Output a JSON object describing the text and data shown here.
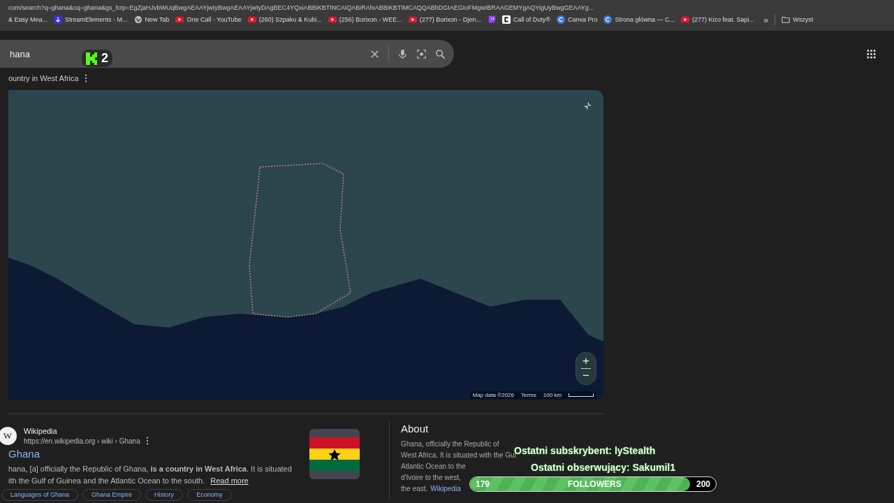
{
  "address_bar": {
    "url": "com/search?q=ghana&oq=ghana&gs_lcrp=EgZjaHJvbWUqBwgAEAAYjwIyBwgAEAAYjwIyDAgBEC4YQxiABBiKBTINCAIQABiRAhiABBiKBTIMCAQQABhDGIAEGIoFMgwIBRAAGEMYgAQYigUyBwgGEAAYg..."
  },
  "bookmarks": [
    {
      "kind": "none",
      "label": "& Easy Mea..."
    },
    {
      "kind": "streamelements",
      "label": "StreamElements - M..."
    },
    {
      "kind": "globe",
      "label": "New Tab"
    },
    {
      "kind": "youtube",
      "label": "One Call - YouTube"
    },
    {
      "kind": "youtube",
      "label": "(260) Szpaku & Kubi..."
    },
    {
      "kind": "youtube",
      "label": "(256) Borixon - WEE..."
    },
    {
      "kind": "youtube",
      "label": "(277) Borixon - Djen..."
    },
    {
      "kind": "twitch"
    },
    {
      "kind": "cod",
      "label": "Call of Duty®"
    },
    {
      "kind": "canva",
      "label": "Canva Pro"
    },
    {
      "kind": "canva",
      "label": "Strona główna — C..."
    },
    {
      "kind": "youtube",
      "label": "(277) Kizo feat. Sapi..."
    }
  ],
  "bookmarks_more": "»",
  "bookmarks_folder": "Wszyst",
  "search": {
    "value": "hana"
  },
  "stream_badge": {
    "count": "2"
  },
  "subtitle": "ountry in West Africa",
  "map": {
    "attribution": "Map data ©2026",
    "terms": "Terms",
    "scale": "100 km",
    "zoom_in": "+",
    "zoom_out": "−"
  },
  "result": {
    "logo_letter": "W",
    "site": "Wikipedia",
    "breadcrumb": "https://en.wikipedia.org › wiki › Ghana",
    "title": "Ghana",
    "snippet": [
      "hana, [a] officially the Republic of Ghana, **is a country in West Africa**. It is situated",
      "ith the Gulf of Guinea and the Atlantic Ocean to the south."
    ],
    "read_more": "Read more",
    "chips": [
      "Languages of Ghana",
      "Ghana Empire",
      "History",
      "Economy"
    ]
  },
  "about": {
    "heading": "About",
    "lines": [
      "Ghana, officially the Republic of",
      "West Africa. It is situated with the Gul",
      "Atlantic Ocean to the",
      "d'Ivoire to the west,",
      "the east."
    ],
    "link": "Wikipedia"
  },
  "overlay": {
    "subscriber": "Ostatni subskrybent: lyStealth",
    "follower": "Ostatni obserwujący: Sakumil1",
    "goal": {
      "current": "179",
      "label": "FOLLOWERS",
      "target": "200",
      "level": 0.895
    }
  }
}
